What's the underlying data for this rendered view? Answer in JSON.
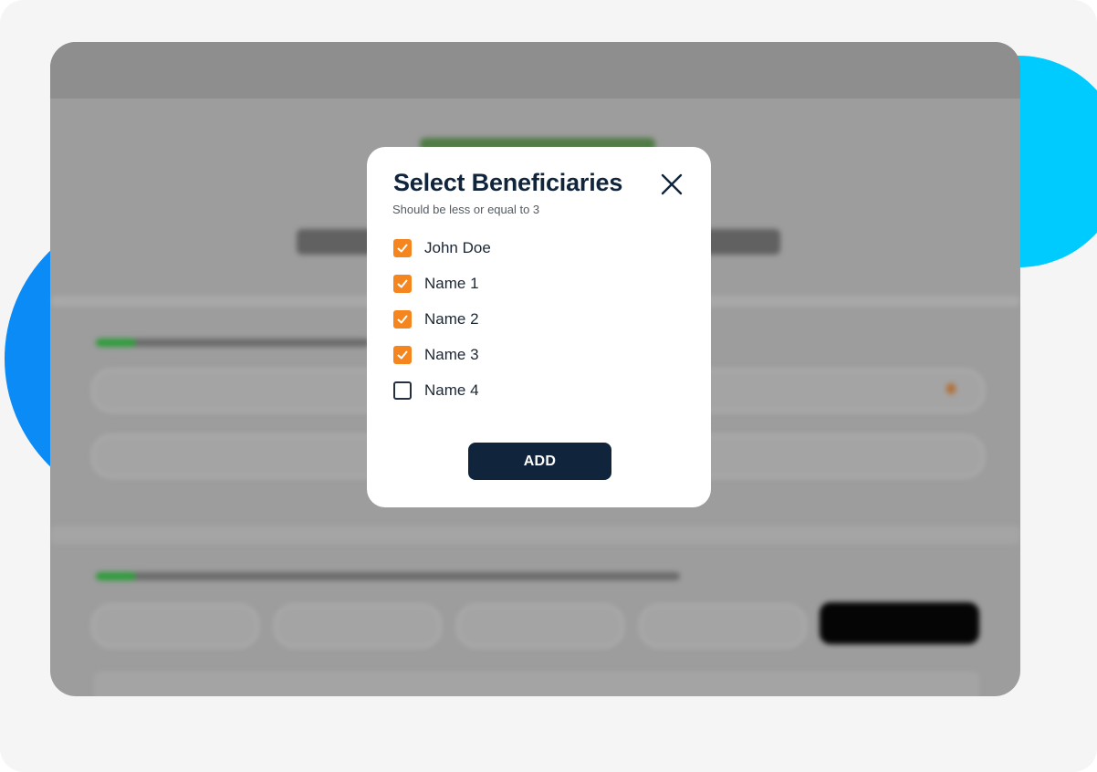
{
  "modal": {
    "title": "Select Beneficiaries",
    "subtitle": "Should be less or equal to 3",
    "close_icon": "close-icon",
    "options": [
      {
        "label": "John Doe",
        "checked": true
      },
      {
        "label": "Name 1",
        "checked": true
      },
      {
        "label": "Name 2",
        "checked": true
      },
      {
        "label": "Name 3",
        "checked": true
      },
      {
        "label": "Name 4",
        "checked": false
      }
    ],
    "add_label": "ADD"
  },
  "colors": {
    "accent": "#f5861f",
    "primary": "#10253c",
    "blob_cyan": "#00cbfe",
    "blob_blue": "#0a8bf5"
  }
}
